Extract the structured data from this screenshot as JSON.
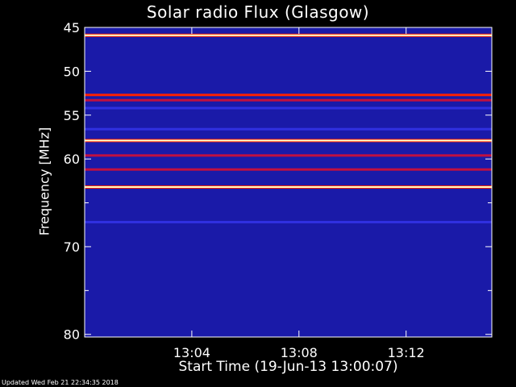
{
  "chart_data": {
    "type": "heatmap",
    "title": "Solar radio Flux (Glasgow)",
    "xlabel": "Start Time (19-Jun-13 13:00:07)",
    "ylabel": "Frequency [MHz]",
    "x_axis": {
      "range_minutes": [
        0,
        15.2
      ],
      "ticks": [
        {
          "value": 4,
          "label": "13:04"
        },
        {
          "value": 8,
          "label": "13:08"
        },
        {
          "value": 12,
          "label": "13:12"
        }
      ]
    },
    "y_axis": {
      "range": [
        45,
        80.3
      ],
      "inverted": true,
      "ticks": [
        {
          "value": 45,
          "label": "45"
        },
        {
          "value": 50,
          "label": "50"
        },
        {
          "value": 55,
          "label": "55"
        },
        {
          "value": 60,
          "label": "60"
        },
        {
          "value": 65,
          "label": ""
        },
        {
          "value": 70,
          "label": "70"
        },
        {
          "value": 75,
          "label": ""
        },
        {
          "value": 80,
          "label": "80"
        }
      ]
    },
    "intensity_bands_mhz": [
      {
        "freq": 45.9,
        "level": 1.0
      },
      {
        "freq": 52.7,
        "level": 0.8
      },
      {
        "freq": 53.3,
        "level": 0.45
      },
      {
        "freq": 54.2,
        "level": 0.35
      },
      {
        "freq": 56.6,
        "level": 0.3
      },
      {
        "freq": 57.9,
        "level": 0.95
      },
      {
        "freq": 59.6,
        "level": 0.6
      },
      {
        "freq": 61.2,
        "level": 0.5
      },
      {
        "freq": 63.2,
        "level": 1.0
      },
      {
        "freq": 67.2,
        "level": 0.25
      }
    ],
    "background_color": "#1a1aa8",
    "colors": {
      "low": "#0a0a50",
      "mid": "#1a1aa8",
      "high": "#ff2000",
      "peak": "#ffffcc"
    }
  },
  "footer": {
    "text": "Updated Wed Feb 21 22:34:35 2018"
  }
}
